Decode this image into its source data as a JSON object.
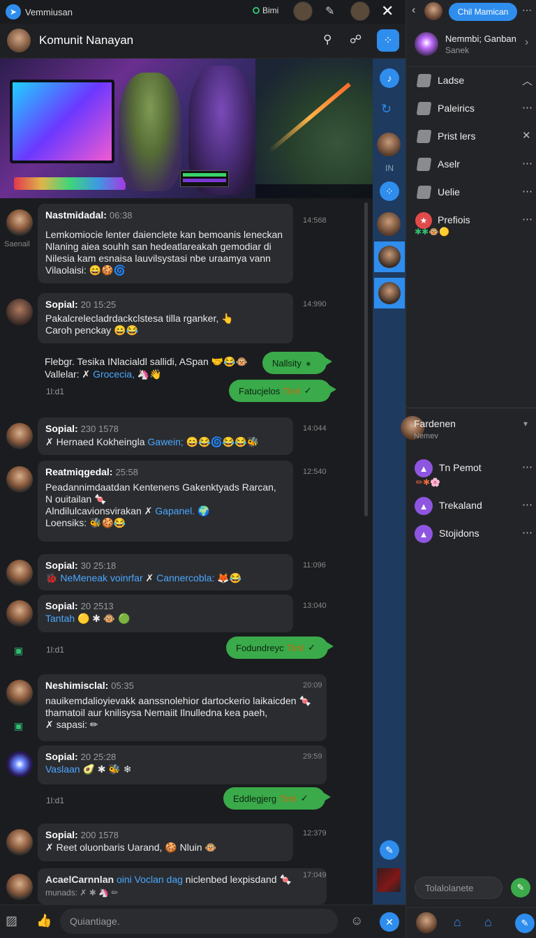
{
  "window": {
    "title": "Vemmiusan",
    "status": "Bimi"
  },
  "header": {
    "title": "Komunit Nanayan"
  },
  "messages": [
    {
      "name": "Nastmidadal:",
      "time": "06:38",
      "lines": [
        "Lemkomiocie lenter daienclete kan bemoanis leneckan",
        "Nlaning aiea souhh san hedeatlareakah gemodiar di",
        "Nilesia kam esnaisa lauvilsystasi nbe uraamya vann",
        "Vilaolaisi:"
      ],
      "stamp": "14:568",
      "side": "Saenail"
    },
    {
      "name": "Sopial:",
      "time": "20 15:25",
      "lines": [
        "Pakalcrelecladrdackclstesa tilla rganker,",
        "Caroh penckay"
      ],
      "stamp": "14:990"
    },
    {
      "name": "Sopial:",
      "time": "230 1578",
      "lines": [
        "Hernaed Kokheingla",
        "Gawein;"
      ],
      "stamp": "14:044"
    },
    {
      "name": "Reatmiqgedal:",
      "time": "25:58",
      "lines": [
        "Peadannimdaatdan Kentenens Gakenktyads Rarcan,",
        "N ouitailan",
        "Alndilulcavionsvirakan",
        "Gapanel.",
        "Loensiks:"
      ],
      "stamp": "12:540"
    },
    {
      "name": "Sopial:",
      "time": "30 25:18",
      "lines": [
        "NeMeneak voinrfar",
        "Cannercobla:"
      ],
      "stamp": "11:096"
    },
    {
      "name": "Sopial:",
      "time": "20 2513",
      "lines": [
        "Tantah"
      ],
      "stamp": "13:040"
    },
    {
      "name": "Neshimisclal:",
      "time": "05:35",
      "lines": [
        "nauikemdalioyievakk aanssnolehior dartockerio laikaicden",
        "thamatoil aur knilisysa Nemaiit Ilnulledna kea paeh,",
        "sapasi:"
      ],
      "stamp": "20:09"
    },
    {
      "name": "Sopial:",
      "time": "20 25:28",
      "lines": [
        "Vaslaan"
      ],
      "stamp": "29:59"
    },
    {
      "name": "Sopial:",
      "time": "200 1578",
      "lines": [
        "Reet oluonbaris Uarand,",
        "Nluin"
      ],
      "stamp": "12:379"
    },
    {
      "name": "AcaelCarnnlan",
      "time": "",
      "lines": [
        "oini Voclan dag",
        "niclenbed lexpisdand",
        "munads:"
      ],
      "stamp": "17:049"
    }
  ],
  "plain": {
    "line1": "Flebgr. Tesika INlacialdl sallidi, ASpan",
    "line2a": "Vallelar:",
    "line2b": "Grocecia,",
    "meta": "1l:d1"
  },
  "greens": [
    {
      "text": "Nallsity",
      "tail": ""
    },
    {
      "text": "Fatucjelos",
      "tail": "Tlml"
    },
    {
      "text": "Fodundreyc",
      "tail": "Tlml"
    },
    {
      "text": "Eddlegjerg",
      "tail": "Tlml"
    }
  ],
  "meta_small": [
    "1l:d1",
    "1l:d1",
    "1l:d1"
  ],
  "rail": {
    "label": "IN"
  },
  "input": {
    "placeholder": "Quiantiage."
  },
  "rpanel": {
    "pill": "Chil Mamican",
    "profile_name": "Nemmbi; Ganban",
    "profile_sub": "Sanek",
    "channels": [
      "Ladse",
      "Paleirics",
      "Prist lers",
      "Aselr",
      "Uelie",
      "Prefiois"
    ],
    "section_title": "Fardenen",
    "section_sub": "Nemev",
    "members": [
      "Tn Pemot",
      "Trekaland",
      "Stojidons"
    ],
    "input_placeholder": "Tolalolanete"
  },
  "colors": {
    "accent": "#2f8ded",
    "green": "#3aaa4a",
    "bg": "#1b1c1f"
  }
}
